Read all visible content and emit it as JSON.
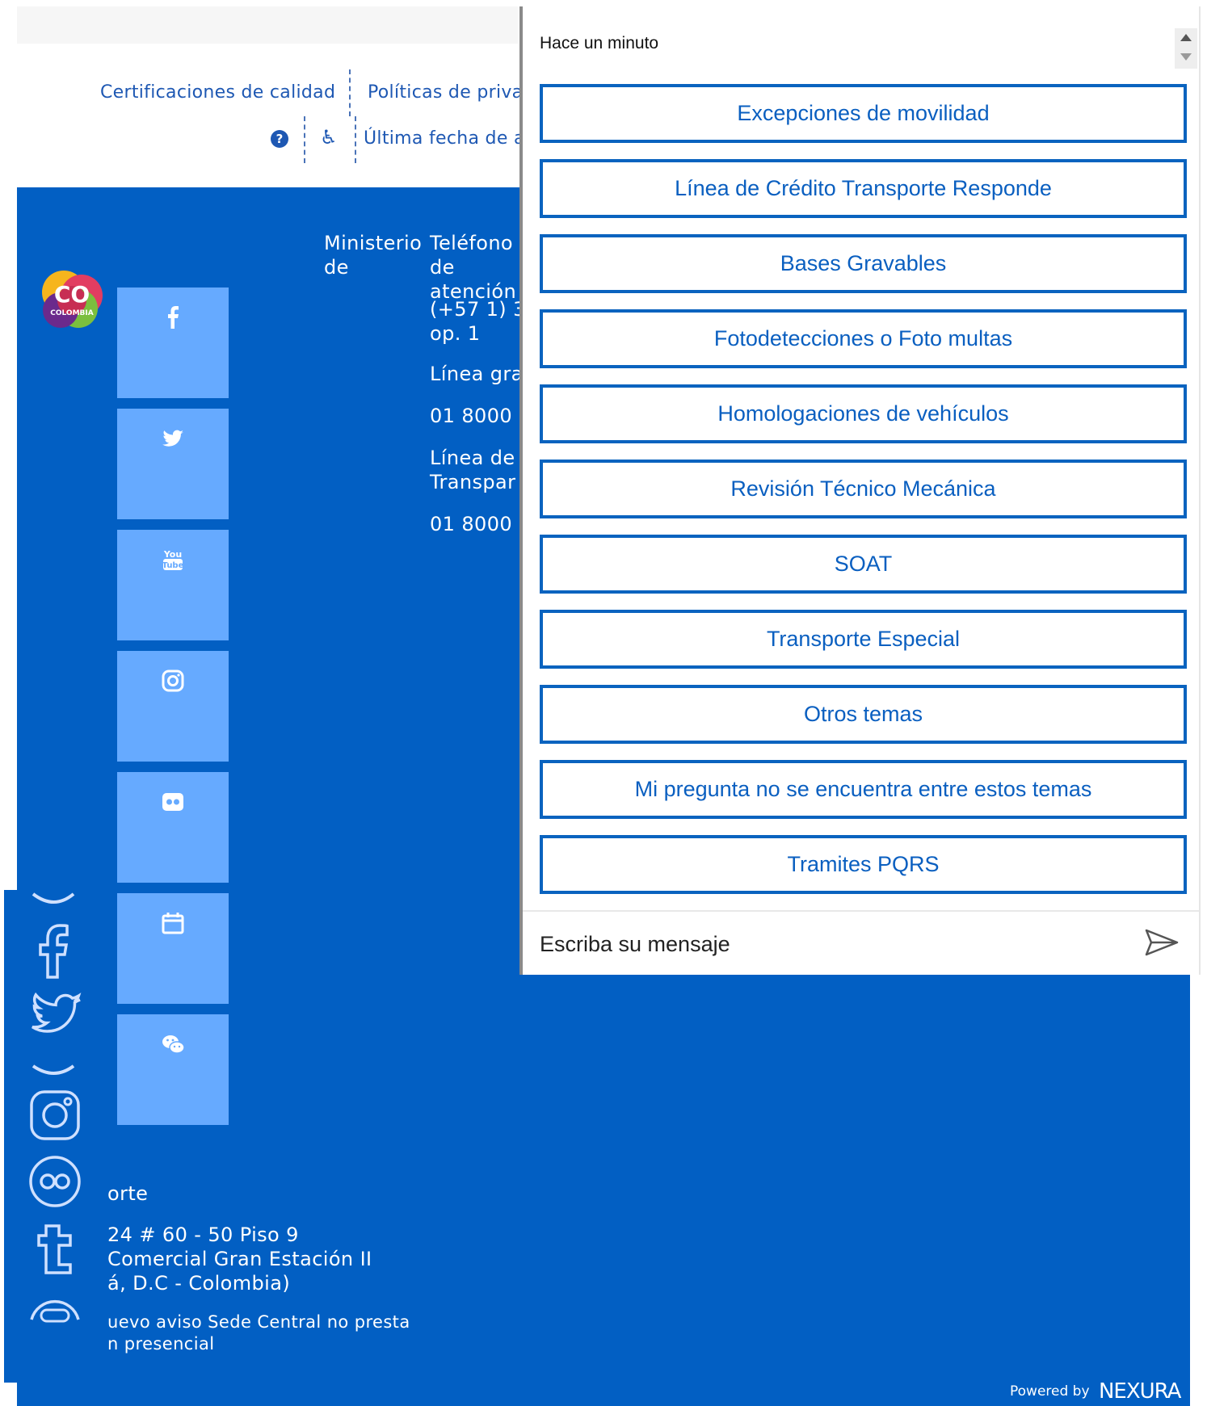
{
  "header_links": {
    "certifications": "Certificaciones de calidad",
    "policies": "Políticas de priva",
    "last_update": "Última fecha de a"
  },
  "footer": {
    "ministry_label": "Ministerio de",
    "phone_label": "Teléfono de atención",
    "phone_number": "(+57 1) 3",
    "phone_option": "op. 1",
    "free_line_label": "Línea gra",
    "free_line_number": "01 8000",
    "transparency_label": "Línea de Transpar",
    "transparency_number": "01 8000",
    "transport_label": "orte",
    "address_line1": "24 # 60 - 50 Piso 9",
    "address_line2": "Comercial Gran Estación II",
    "address_line3": "á, D.C - Colombia)",
    "notice_line1": "uevo aviso Sede Central no presta",
    "notice_line2": "n presencial",
    "logo_text": "CO",
    "logo_subtext": "COLOMBIA"
  },
  "social_icons": [
    "facebook-icon",
    "twitter-icon",
    "youtube-icon",
    "instagram-icon",
    "flickr-icon",
    "calendar-icon",
    "wechat-icon"
  ],
  "powered_by": {
    "label": "Powered by",
    "brand": "NEXURA"
  },
  "chat": {
    "timestamp": "Hace un minuto",
    "options": [
      "Excepciones de movilidad",
      "Línea de Crédito Transporte Responde",
      "Bases Gravables",
      "Fotodetecciones o Foto multas",
      "Homologaciones de vehículos",
      "Revisión Técnico Mecánica",
      "SOAT",
      "Transporte Especial",
      "Otros temas",
      "Mi pregunta no se encuentra entre estos temas",
      "Tramites PQRS"
    ],
    "input_placeholder": "Escriba su mensaje"
  },
  "colors": {
    "footer_blue": "#025fc3",
    "tile_blue": "#66aaff",
    "link_blue": "#1e58b3",
    "button_border": "#0a63bf"
  }
}
